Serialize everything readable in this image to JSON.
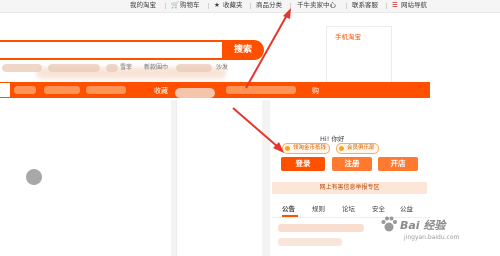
{
  "topbar": {
    "items": [
      {
        "label": "我的淘宝",
        "icon": ""
      },
      {
        "label": "购物车",
        "icon": "cart-icon"
      },
      {
        "label": "收藏夹",
        "icon": "star-icon"
      },
      {
        "label": "商品分类",
        "icon": ""
      },
      {
        "label": "千牛卖家中心",
        "icon": ""
      },
      {
        "label": "联系客服",
        "icon": ""
      },
      {
        "label": "网站导航",
        "icon": "menu-icon"
      }
    ]
  },
  "search": {
    "button_label": "搜索",
    "placeholder": "",
    "hot_words": [
      "雪菲",
      "新款围巾",
      "沙发"
    ]
  },
  "qr": {
    "label": "手机淘宝"
  },
  "nav": {
    "favorites_label": "收藏",
    "right_label": "购"
  },
  "user_panel": {
    "greeting": "Hi! 你好",
    "badges": [
      "领淘金币抵钱",
      "会员俱乐部"
    ],
    "buttons": {
      "login": "登录",
      "register": "注册",
      "open_shop": "开店"
    },
    "banner": "网上有害信息举报专区",
    "tabs": [
      "公告",
      "规则",
      "论坛",
      "安全",
      "公益"
    ]
  },
  "watermark": {
    "brand": "Bai 经验",
    "sub": "jingyan.baidu.com"
  },
  "colors": {
    "accent": "#ff5000",
    "annotation": "#e8352a"
  }
}
